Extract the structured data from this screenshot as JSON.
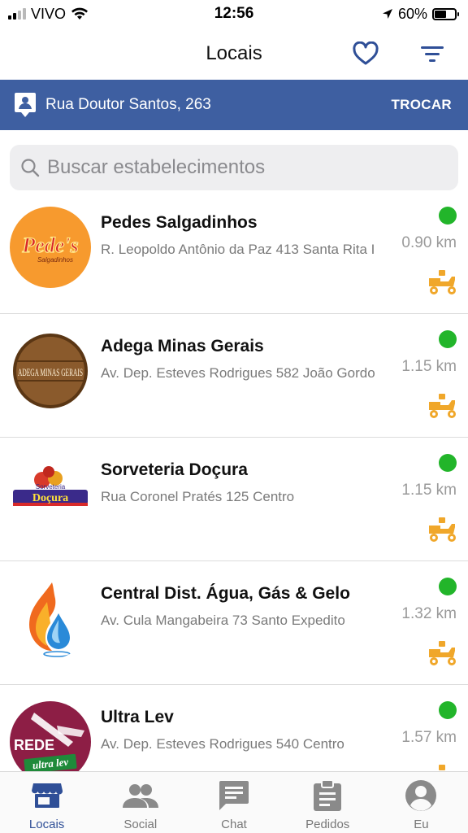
{
  "status_bar": {
    "carrier": "VIVO",
    "time": "12:56",
    "battery": "60%",
    "battery_level": 0.6
  },
  "nav": {
    "title": "Locais",
    "favorites_icon": "heart-icon",
    "filter_icon": "filter-icon"
  },
  "address": {
    "text": "Rua Doutor Santos, 263",
    "action": "TROCAR",
    "icon": "location-pin-person-icon"
  },
  "search": {
    "placeholder": "Buscar estabelecimentos",
    "value": ""
  },
  "stores": [
    {
      "name": "Pedes Salgadinhos",
      "address": "R. Leopoldo Antônio da Paz 413 Santa Rita I",
      "distance": "0.90 km",
      "open": true,
      "status_color": "#22b52a",
      "logo_text": "Pede's",
      "logo_subtext": "Salgadinhos"
    },
    {
      "name": "Adega Minas Gerais",
      "address": "Av. Dep. Esteves Rodrigues 582 João Gordo",
      "distance": "1.15 km",
      "open": true,
      "status_color": "#22b52a",
      "logo_text": "ADEGA MINAS GERAIS",
      "logo_subtext": ""
    },
    {
      "name": "Sorveteria Doçura",
      "address": "Rua Coronel Pratés 125 Centro",
      "distance": "1.15 km",
      "open": true,
      "status_color": "#22b52a",
      "logo_text": "Doçura",
      "logo_subtext": "Sorveteria"
    },
    {
      "name": "Central Dist. Água, Gás & Gelo",
      "address": "Av. Cula Mangabeira 73 Santo Expedito",
      "distance": "1.32 km",
      "open": true,
      "status_color": "#22b52a",
      "logo_text": "",
      "logo_subtext": ""
    },
    {
      "name": "Ultra Lev",
      "address": "Av. Dep. Esteves Rodrigues 540 Centro",
      "distance": "1.57 km",
      "open": true,
      "status_color": "#22b52a",
      "logo_text": "REDE",
      "logo_subtext": "ultra lev"
    }
  ],
  "tabs": [
    {
      "label": "Locais",
      "icon": "store-icon",
      "active": true
    },
    {
      "label": "Social",
      "icon": "people-icon",
      "active": false
    },
    {
      "label": "Chat",
      "icon": "chat-icon",
      "active": false
    },
    {
      "label": "Pedidos",
      "icon": "clipboard-icon",
      "active": false
    },
    {
      "label": "Eu",
      "icon": "account-icon",
      "active": false
    }
  ],
  "colors": {
    "primary": "#3e5fa1",
    "accent": "#2f4f97",
    "status_open": "#22b52a",
    "delivery": "#f0a72a"
  }
}
